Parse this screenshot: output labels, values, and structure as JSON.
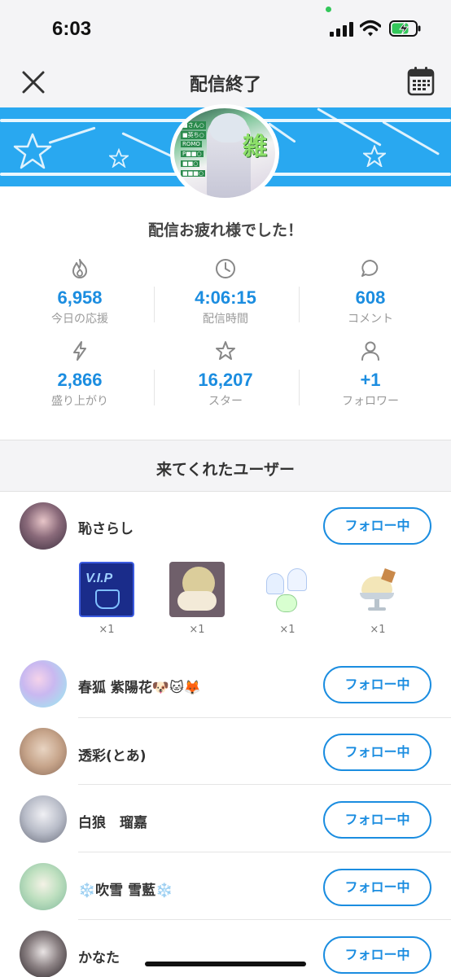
{
  "status_bar": {
    "time": "6:03"
  },
  "header": {
    "title": "配信終了"
  },
  "message": "配信お疲れ様でした！",
  "stats": [
    {
      "icon": "flame-icon",
      "value": "6,958",
      "label": "今日の応援"
    },
    {
      "icon": "clock-icon",
      "value": "4:06:15",
      "label": "配信時間"
    },
    {
      "icon": "comment-icon",
      "value": "608",
      "label": "コメント"
    },
    {
      "icon": "lightning-icon",
      "value": "2,866",
      "label": "盛り上がり"
    },
    {
      "icon": "star-icon",
      "value": "16,207",
      "label": "スター"
    },
    {
      "icon": "user-icon",
      "value": "+1",
      "label": "フォロワー"
    }
  ],
  "visitors_title": "来てくれたユーザー",
  "follow_label": "フォロー中",
  "users": [
    {
      "name": "恥さらし",
      "gifts": [
        {
          "icon": "vip-cake-gift-icon",
          "count": "×1"
        },
        {
          "icon": "sleeping-bun-gift-icon",
          "count": "×1"
        },
        {
          "icon": "ghost-sticker-gift-icon",
          "count": "×1"
        },
        {
          "icon": "ice-cream-gift-icon",
          "count": "×1"
        }
      ]
    },
    {
      "name": "春狐 紫陽花🐶🐱🦊"
    },
    {
      "name": "透彩(とあ)"
    },
    {
      "name": "白狼　瑠嘉"
    },
    {
      "name": "❄️吹雪 雪藍❄️"
    },
    {
      "name": "かなた"
    }
  ],
  "colors": {
    "accent": "#1b8de0",
    "banner": "#29a8f0",
    "header_bg": "#f4f4f6"
  }
}
